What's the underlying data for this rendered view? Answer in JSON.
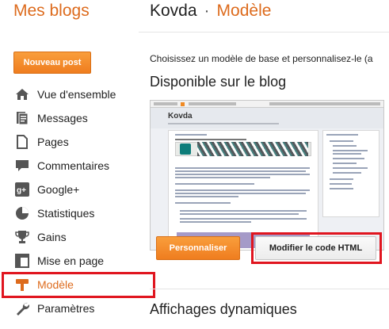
{
  "sidebar": {
    "title": "Mes blogs",
    "new_post": "Nouveau post",
    "items": [
      {
        "label": "Vue d'ensemble",
        "icon": "home-icon"
      },
      {
        "label": "Messages",
        "icon": "posts-icon"
      },
      {
        "label": "Pages",
        "icon": "pages-icon"
      },
      {
        "label": "Commentaires",
        "icon": "comment-icon"
      },
      {
        "label": "Google+",
        "icon": "google-plus-icon"
      },
      {
        "label": "Statistiques",
        "icon": "stats-icon"
      },
      {
        "label": "Gains",
        "icon": "trophy-icon"
      },
      {
        "label": "Mise en page",
        "icon": "layout-icon"
      },
      {
        "label": "Modèle",
        "icon": "template-icon"
      },
      {
        "label": "Paramètres",
        "icon": "wrench-icon"
      }
    ],
    "active": "Modèle"
  },
  "header": {
    "blog_name": "Kovda",
    "separator": "·",
    "section": "Modèle"
  },
  "main": {
    "intro": "Choisissez un modèle de base et personnalisez-le (a",
    "available_title": "Disponible sur le blog",
    "preview": {
      "blog_title": "Kovda"
    },
    "customize_button": "Personnaliser",
    "edit_html_button": "Modifier le code HTML",
    "dynamic_title": "Affichages dynamiques"
  },
  "colors": {
    "accent": "#dd6b1d",
    "highlight": "#e0151f"
  }
}
